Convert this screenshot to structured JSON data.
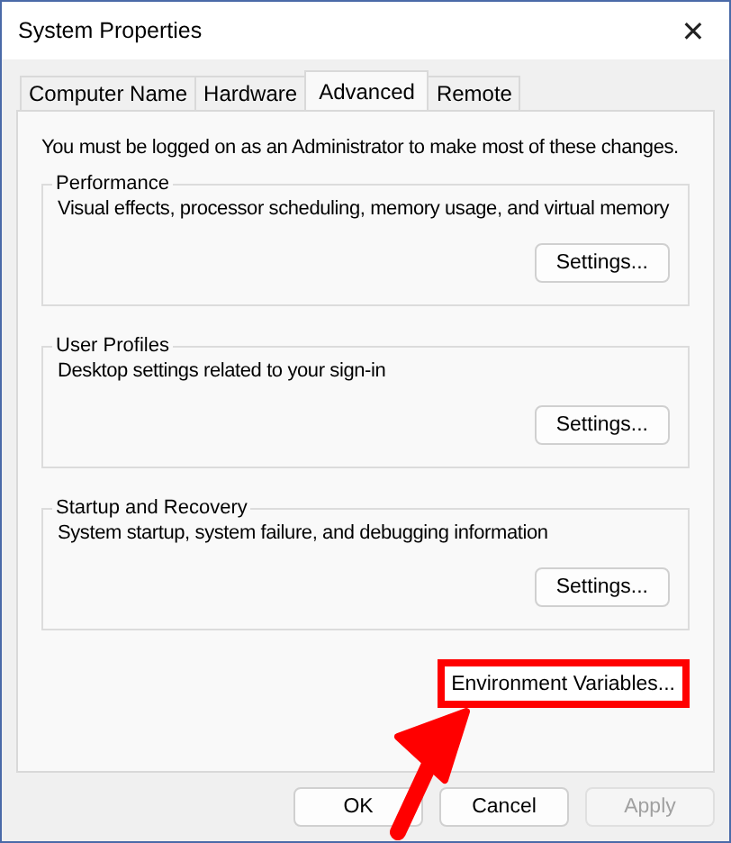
{
  "window": {
    "title": "System Properties",
    "close": "✕"
  },
  "tabs": [
    {
      "label": "Computer Name",
      "selected": false
    },
    {
      "label": "Hardware",
      "selected": false
    },
    {
      "label": "Advanced",
      "selected": true
    },
    {
      "label": "Remote",
      "selected": false
    }
  ],
  "notice": "You must be logged on as an Administrator to make most of these changes.",
  "groups": [
    {
      "title": "Performance",
      "description": "Visual effects, processor scheduling, memory usage, and virtual memory",
      "button": "Settings..."
    },
    {
      "title": "User Profiles",
      "description": "Desktop settings related to your sign-in",
      "button": "Settings..."
    },
    {
      "title": "Startup and Recovery",
      "description": "System startup, system failure, and debugging information",
      "button": "Settings..."
    }
  ],
  "environment_button": {
    "label": "Environment Variables...",
    "highlighted": true
  },
  "buttons": [
    {
      "label": "OK",
      "disabled": false
    },
    {
      "label": "Cancel",
      "disabled": false
    },
    {
      "label": "Apply",
      "disabled": true
    }
  ]
}
